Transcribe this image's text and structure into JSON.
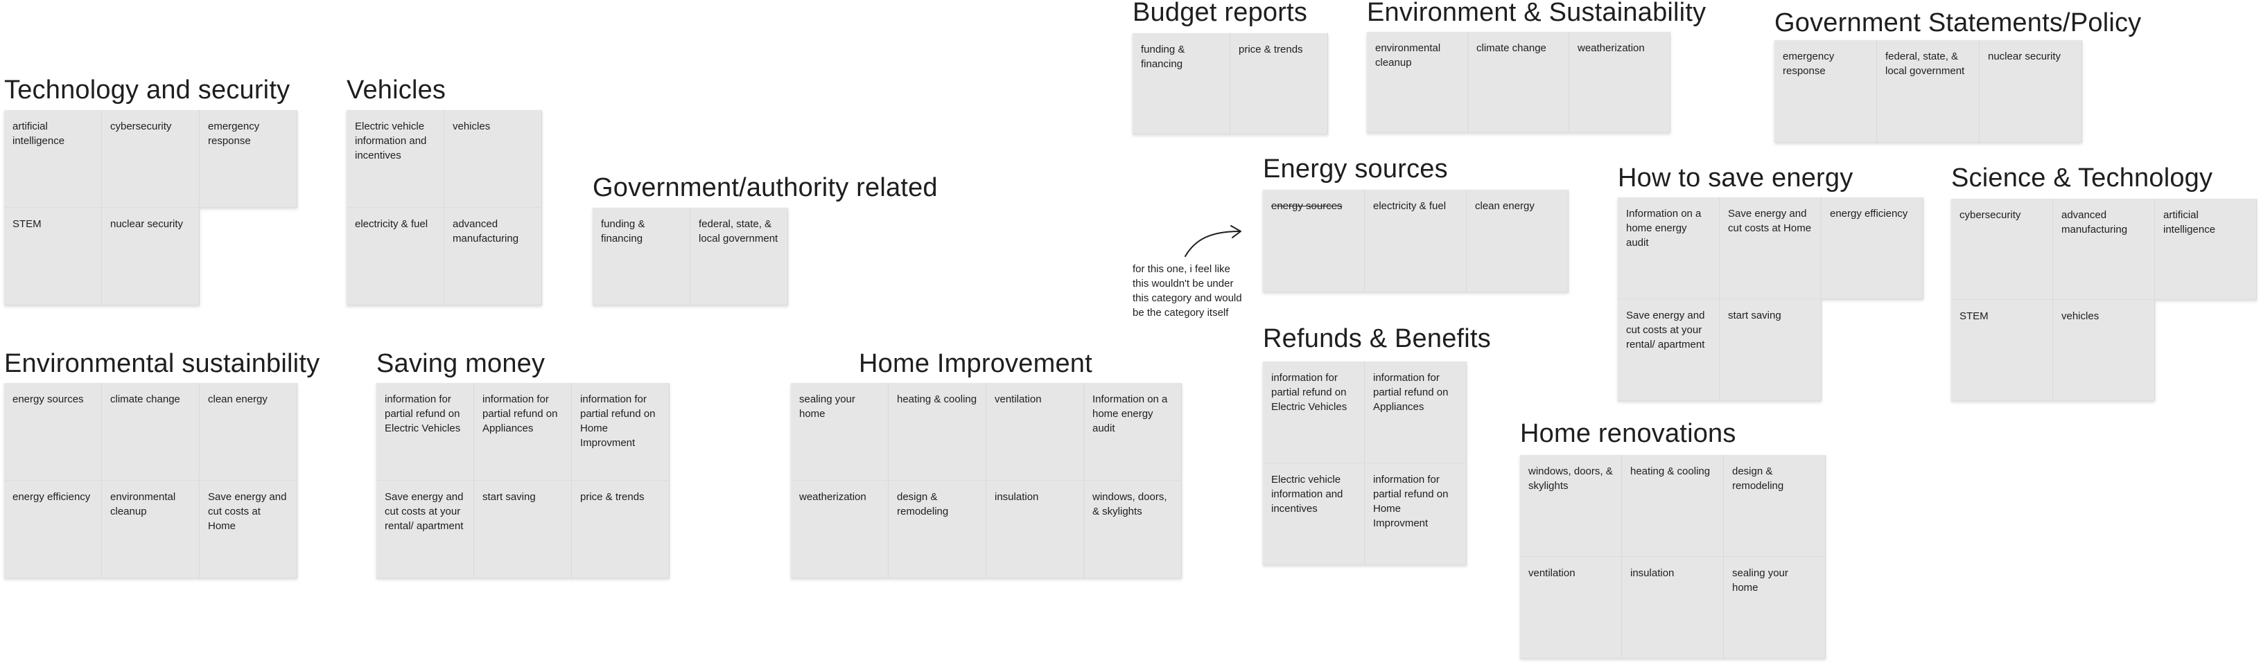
{
  "groups": [
    {
      "title": "Technology and security",
      "notes": [
        {
          "text": "artificial intelligence"
        },
        {
          "text": "cybersecurity"
        },
        {
          "text": "emergency response"
        },
        {
          "text": "STEM"
        },
        {
          "text": "nuclear security"
        }
      ]
    },
    {
      "title": "Vehicles",
      "notes": [
        {
          "text": "Electric vehicle information and incentives"
        },
        {
          "text": "vehicles"
        },
        {
          "text": "electricity & fuel"
        },
        {
          "text": "advanced manufacturing"
        }
      ]
    },
    {
      "title": "Government/authority related",
      "notes": [
        {
          "text": "funding & financing"
        },
        {
          "text": "federal, state, & local government"
        }
      ]
    },
    {
      "title": "Budget reports",
      "notes": [
        {
          "text": "funding & financing"
        },
        {
          "text": "price & trends"
        }
      ]
    },
    {
      "title": "Environment & Sustainability",
      "notes": [
        {
          "text": "environmental cleanup"
        },
        {
          "text": "climate change"
        },
        {
          "text": "weatherization"
        }
      ]
    },
    {
      "title": "Government Statements/Policy",
      "notes": [
        {
          "text": "emergency response"
        },
        {
          "text": "federal, state, & local government"
        },
        {
          "text": "nuclear security"
        }
      ]
    },
    {
      "title": "Energy sources",
      "notes": [
        {
          "text": "energy sources",
          "strikethrough": true
        },
        {
          "text": "electricity & fuel"
        },
        {
          "text": "clean energy"
        }
      ]
    },
    {
      "title": "How to save energy",
      "notes": [
        {
          "text": "Information on a home energy audit"
        },
        {
          "text": "Save energy and cut costs at Home"
        },
        {
          "text": "energy efficiency"
        },
        {
          "text": "Save energy and cut costs at your rental/ apartment"
        },
        {
          "text": "start saving"
        }
      ]
    },
    {
      "title": "Science & Technology",
      "notes": [
        {
          "text": "cybersecurity"
        },
        {
          "text": "advanced manufacturing"
        },
        {
          "text": "artificial intelligence"
        },
        {
          "text": "STEM"
        },
        {
          "text": "vehicles"
        }
      ]
    },
    {
      "title": "Refunds & Benefits",
      "notes": [
        {
          "text": "information for partial refund on Electric Vehicles"
        },
        {
          "text": "information for partial refund on Appliances"
        },
        {
          "text": "Electric vehicle information and incentives"
        },
        {
          "text": "information for partial refund on Home Improvment"
        }
      ]
    },
    {
      "title": "Environmental sustainbility",
      "notes": [
        {
          "text": "energy sources"
        },
        {
          "text": "climate change"
        },
        {
          "text": "clean energy"
        },
        {
          "text": "energy efficiency"
        },
        {
          "text": "environmental cleanup"
        },
        {
          "text": "Save energy and cut costs at Home"
        }
      ]
    },
    {
      "title": "Saving money",
      "notes": [
        {
          "text": "information for partial refund on Electric Vehicles"
        },
        {
          "text": "information for partial refund on Appliances"
        },
        {
          "text": "information for partial refund on Home Improvment"
        },
        {
          "text": "Save energy and cut costs at your rental/ apartment"
        },
        {
          "text": "start saving"
        },
        {
          "text": "price & trends"
        }
      ]
    },
    {
      "title": "Home Improvement",
      "notes": [
        {
          "text": "sealing your home"
        },
        {
          "text": "heating & cooling"
        },
        {
          "text": "ventilation"
        },
        {
          "text": "Information on a home energy audit"
        },
        {
          "text": "weatherization"
        },
        {
          "text": "design & remodeling"
        },
        {
          "text": "insulation"
        },
        {
          "text": "windows, doors, & skylights"
        }
      ]
    },
    {
      "title": "Home renovations",
      "notes": [
        {
          "text": "windows, doors, & skylights"
        },
        {
          "text": "heating & cooling"
        },
        {
          "text": "design & remodeling"
        },
        {
          "text": "ventilation"
        },
        {
          "text": "insulation"
        },
        {
          "text": "sealing your home"
        }
      ]
    }
  ],
  "comment": "for this one, i feel like this wouldn't be under this category and would be the category itself"
}
